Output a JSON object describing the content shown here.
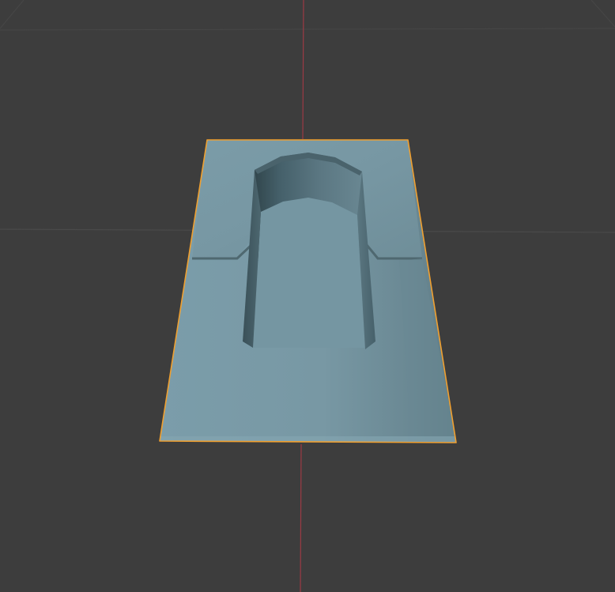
{
  "viewport": {
    "background_color": "#3d3d3d",
    "grid_line_color": "#4a4a4a",
    "y_axis_color": "#9c3a44",
    "selection_outline_color": "#f0a030",
    "mesh_base_color": "#7a9ba7",
    "mesh_shadow_color": "#556f78",
    "mesh_dark_color": "#3f565d"
  },
  "scene": {
    "selected_object": "plane-mesh-with-arched-recess"
  }
}
